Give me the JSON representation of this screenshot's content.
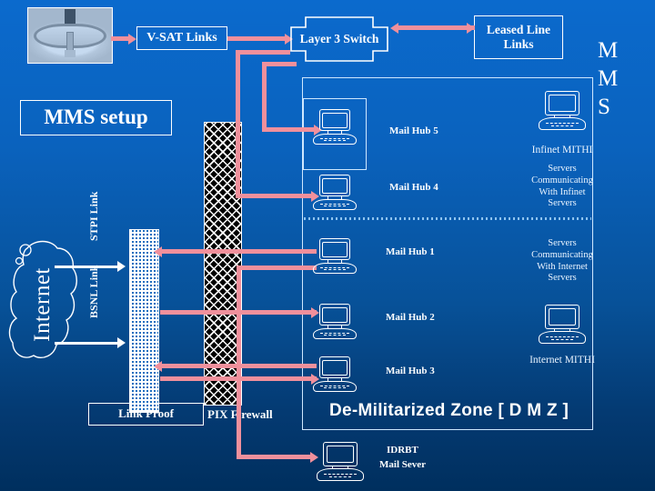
{
  "slide": {
    "title": "MMS setup",
    "side_letters": [
      "M",
      "M",
      "S"
    ],
    "dmz_title": "De-Militarized Zone [ D M Z ]"
  },
  "colors": {
    "background_top": "#0b6acd",
    "background_bottom": "#002f5e",
    "line_pink": "#f0909c",
    "line_white": "#ffffff",
    "box_border": "#ffffff",
    "firewall_fill": "#000000",
    "linkproof_fill": "#1f6fbf"
  },
  "nodes": {
    "satellite_dish": "satellite-dish-photo",
    "vsat_links": "V-SAT Links",
    "layer3_switch": "Layer 3 Switch",
    "leased_line_links": "Leased Line\nLinks",
    "leased_line_1": "Leased Line",
    "leased_line_2": "Links",
    "internet_cloud": "Internet",
    "stpi_link": "STPI  Link",
    "bsnl_link": "BSNL  Link",
    "link_proof": "Link Proof",
    "pix_firewall": "PIX  Firewall"
  },
  "hubs": [
    {
      "label": "Mail Hub 5"
    },
    {
      "label": "Mail Hub 4"
    },
    {
      "label": "Mail Hub 1"
    },
    {
      "label": "Mail Hub 2"
    },
    {
      "label": "Mail Hub 3"
    }
  ],
  "right_column": {
    "infinet_mithi": "Infinet  MITHI",
    "infinet_note": "Servers\nCommunicating\nWith Infinet\nServers",
    "infinet_note_lines": [
      "Servers",
      "Communicating",
      "With Infinet",
      "Servers"
    ],
    "internet_note_lines": [
      "Servers",
      "Communicating",
      "With Internet",
      "Servers"
    ],
    "internet_mithi": "Internet MITHI"
  },
  "bottom": {
    "idrbt_line1": "IDRBT",
    "idrbt_line2": "Mail Sever"
  }
}
